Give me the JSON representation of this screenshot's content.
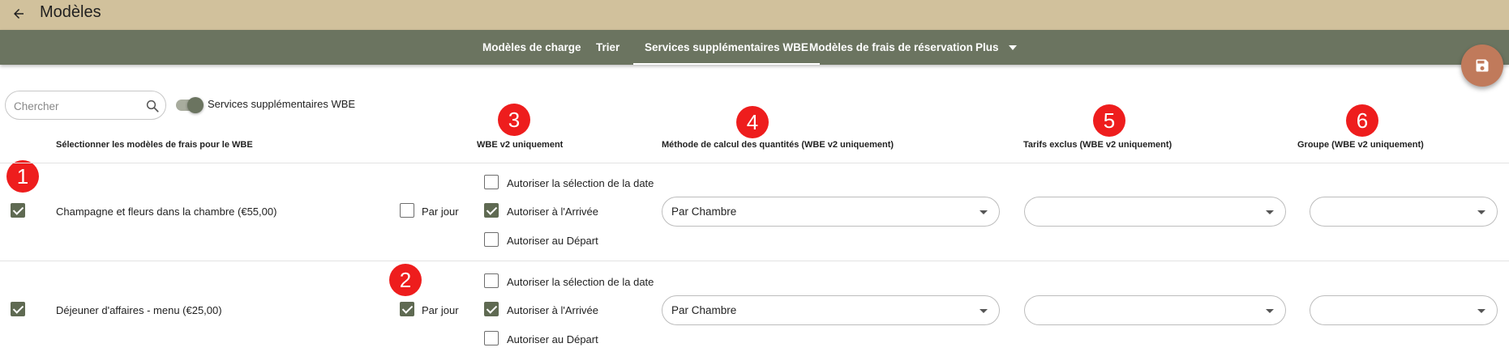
{
  "header": {
    "title": "Modèles",
    "back_icon": "arrow-left-icon"
  },
  "tabs": [
    {
      "label": "Modèles de charge",
      "active": false
    },
    {
      "label": "Trier",
      "active": false
    },
    {
      "label": "Services supplémentaires WBE",
      "active": true
    },
    {
      "label": "Modèles de frais de réservation",
      "active": false
    },
    {
      "label": "Plus",
      "active": false
    }
  ],
  "save_button": {
    "icon": "floppy-disk-icon",
    "color": "#c07a5b"
  },
  "search": {
    "placeholder": "Chercher",
    "value": ""
  },
  "toggle": {
    "label": "Services supplémentaires WBE",
    "on": true
  },
  "columns": {
    "select": "Sélectionner les modèles de frais pour le WBE",
    "wbe_v2": "WBE v2 uniquement",
    "method": "Méthode de calcul des quantités (WBE v2 uniquement)",
    "excluded_rates": "Tarifs exclus (WBE v2 uniquement)",
    "group": "Groupe (WBE v2 uniquement)"
  },
  "markers": [
    "1",
    "2",
    "3",
    "4",
    "5",
    "6"
  ],
  "rows": [
    {
      "selected": true,
      "name": "Champagne et fleurs dans la chambre (€55,00)",
      "per_day_label": "Par jour",
      "per_day": false,
      "options": [
        {
          "label": "Autoriser la sélection de la date",
          "checked": false
        },
        {
          "label": "Autoriser à l'Arrivée",
          "checked": true
        },
        {
          "label": "Autoriser au Départ",
          "checked": false
        }
      ],
      "method": "Par Chambre",
      "excluded_rates": "",
      "group": ""
    },
    {
      "selected": true,
      "name": "Déjeuner d'affaires - menu (€25,00)",
      "per_day_label": "Par jour",
      "per_day": true,
      "options": [
        {
          "label": "Autoriser la sélection de la date",
          "checked": false
        },
        {
          "label": "Autoriser à l'Arrivée",
          "checked": true
        },
        {
          "label": "Autoriser au Départ",
          "checked": false
        }
      ],
      "method": "Par Chambre",
      "excluded_rates": "",
      "group": ""
    }
  ]
}
